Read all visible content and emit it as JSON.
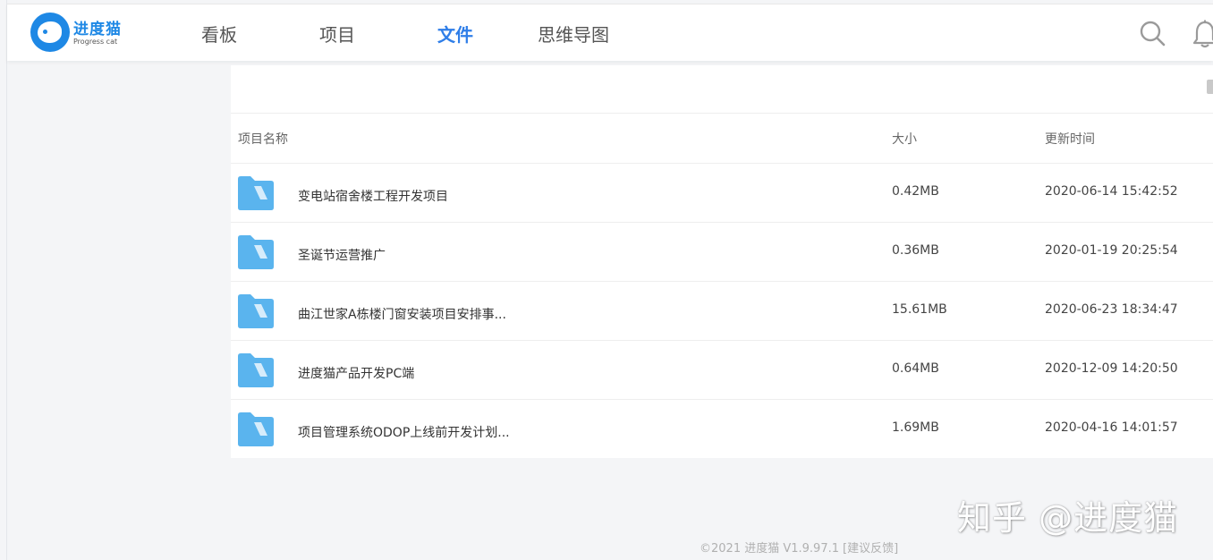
{
  "brand": {
    "name": "进度猫",
    "tagline": "Progress cat",
    "accent_color": "#1e88e5"
  },
  "nav": {
    "items": [
      {
        "label": "看板",
        "active": false
      },
      {
        "label": "项目",
        "active": false
      },
      {
        "label": "文件",
        "active": true
      },
      {
        "label": "思维导图",
        "active": false
      }
    ],
    "active_color": "#2f7ee8",
    "icons": [
      "search-icon",
      "bell-icon"
    ]
  },
  "table": {
    "columns": {
      "name": "项目名称",
      "size": "大小",
      "updated": "更新时间"
    },
    "rows": [
      {
        "icon": "folder-icon",
        "name": "变电站宿舍楼工程开发项目",
        "size": "0.42MB",
        "updated": "2020-06-14 15:42:52"
      },
      {
        "icon": "folder-icon",
        "name": "圣诞节运营推广",
        "size": "0.36MB",
        "updated": "2020-01-19 20:25:54"
      },
      {
        "icon": "folder-icon",
        "name": "曲江世家A栋楼门窗安装项目安排事...",
        "size": "15.61MB",
        "updated": "2020-06-23 18:34:47"
      },
      {
        "icon": "folder-icon",
        "name": "进度猫产品开发PC端",
        "size": "0.64MB",
        "updated": "2020-12-09 14:20:50"
      },
      {
        "icon": "folder-icon",
        "name": "项目管理系统ODOP上线前开发计划...",
        "size": "1.69MB",
        "updated": "2020-04-16 14:01:57"
      }
    ],
    "folder_color": "#5ab4ee"
  },
  "watermark": "知乎 @进度猫",
  "footer": {
    "copyright": "©2021 进度猫 V1.9.97.1",
    "feedback_link": "[建议反馈]"
  }
}
